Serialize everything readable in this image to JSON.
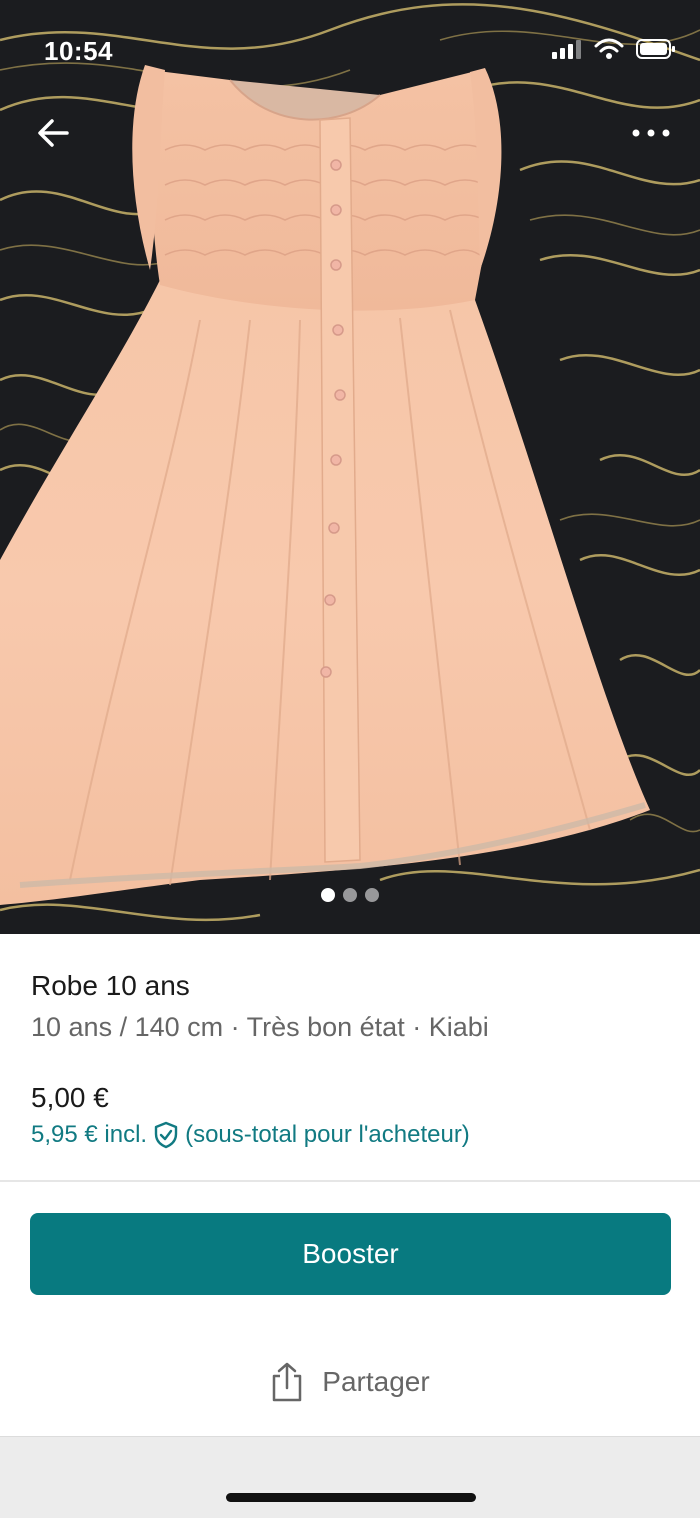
{
  "status_bar": {
    "time": "10:54"
  },
  "nav": {
    "back_icon": "arrow-left-icon",
    "more_icon": "more-horizontal-icon"
  },
  "gallery": {
    "image_count": 3,
    "active_index": 0
  },
  "item": {
    "title": "Robe 10 ans",
    "details": "10 ans / 140 cm · Très bon état · Kiabi",
    "price": "5,00 €",
    "buyer_price": "5,95 € incl.",
    "buyer_note": "(sous-total pour l'acheteur)"
  },
  "actions": {
    "booster_label": "Booster",
    "share_label": "Partager"
  },
  "colors": {
    "accent": "#087a80",
    "accent_text": "#117a82"
  }
}
